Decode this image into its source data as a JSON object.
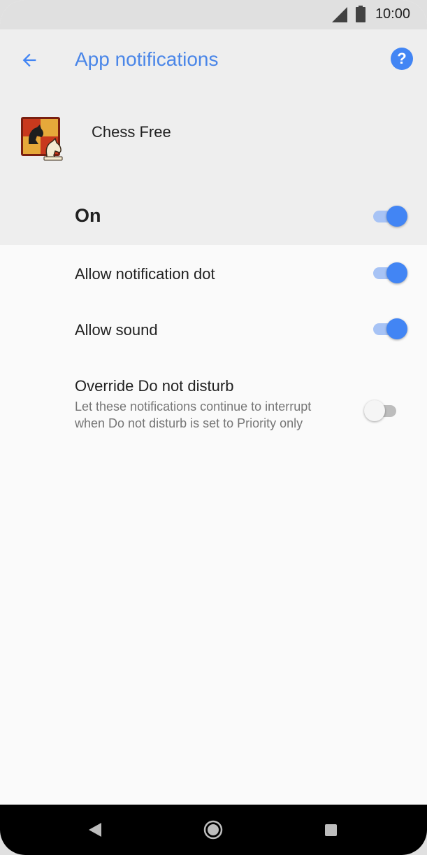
{
  "status_bar": {
    "time": "10:00"
  },
  "header": {
    "title": "App notifications",
    "app_name": "Chess Free",
    "master_label": "On",
    "master_on": true
  },
  "settings": [
    {
      "label": "Allow notification dot",
      "on": true
    },
    {
      "label": "Allow sound",
      "on": true
    },
    {
      "label": "Override Do not disturb",
      "description": "Let these notifications continue to interrupt when Do not disturb is set to Priority only",
      "on": false
    }
  ],
  "colors": {
    "accent": "#4285f4",
    "header_bg": "#eeeeee",
    "content_bg": "#fafafa",
    "nav_bg": "#000000"
  }
}
